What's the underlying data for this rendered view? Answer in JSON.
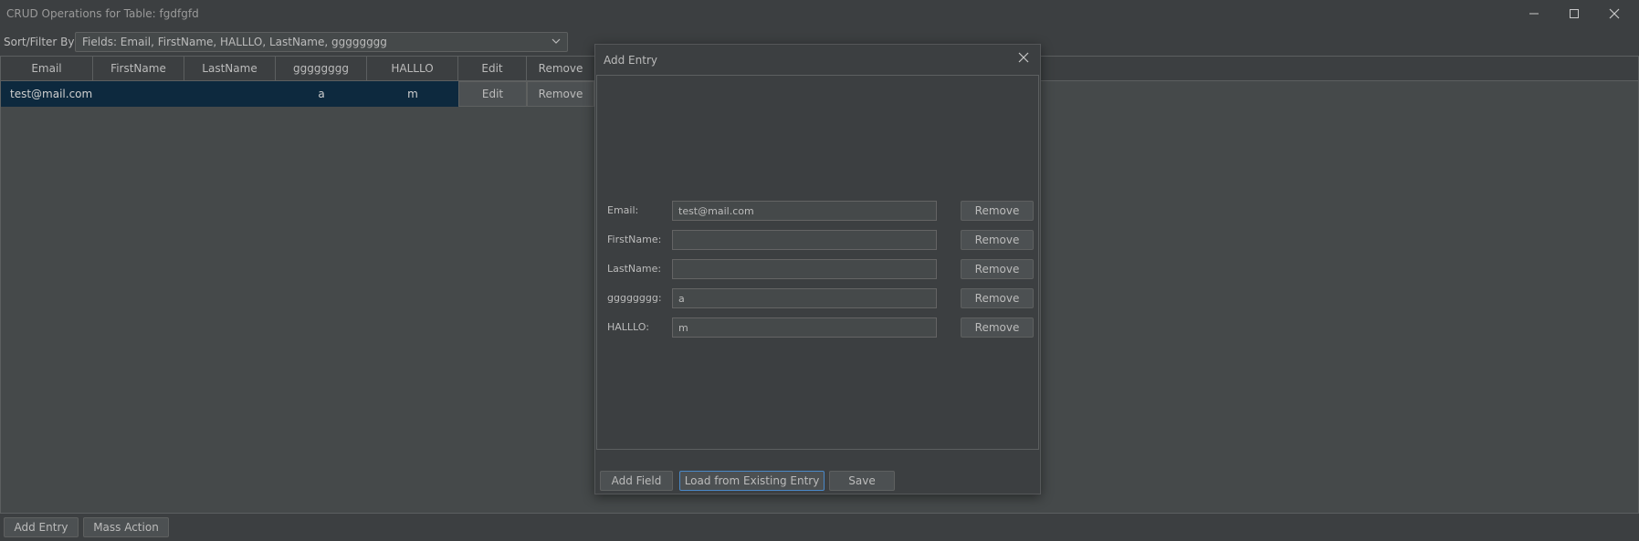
{
  "window": {
    "title": "CRUD Operations for Table: fgdfgfd",
    "icons": {
      "minimize": "minimize-icon",
      "maximize": "maximize-icon",
      "close": "close-icon"
    }
  },
  "filter": {
    "label": "Sort/Filter By:",
    "value": "Fields: Email, FirstName, HALLLO, LastName, gggggggg"
  },
  "table": {
    "columns": [
      "Email",
      "FirstName",
      "LastName",
      "gggggggg",
      "HALLLO",
      "Edit",
      "Remove"
    ],
    "rows": [
      {
        "email": "test@mail.com",
        "firstname": "",
        "lastname": "",
        "gggggggg": "a",
        "hallo": "m",
        "edit": "Edit",
        "remove": "Remove"
      }
    ]
  },
  "bottom": {
    "add_entry": "Add Entry",
    "mass_action": "Mass Action"
  },
  "dialog": {
    "title": "Add Entry",
    "fields": [
      {
        "label": "Email:",
        "value": "test@mail.com",
        "remove": "Remove"
      },
      {
        "label": "FirstName:",
        "value": "",
        "remove": "Remove"
      },
      {
        "label": "LastName:",
        "value": "",
        "remove": "Remove"
      },
      {
        "label": "gggggggg:",
        "value": "a",
        "remove": "Remove"
      },
      {
        "label": "HALLLO:",
        "value": "m",
        "remove": "Remove"
      }
    ],
    "buttons": {
      "add_field": "Add Field",
      "load_existing": "Load from Existing Entry",
      "save": "Save"
    }
  },
  "colors": {
    "background": "#3c3f41",
    "selected_row": "#0d293e",
    "focus": "#4a88c7"
  }
}
